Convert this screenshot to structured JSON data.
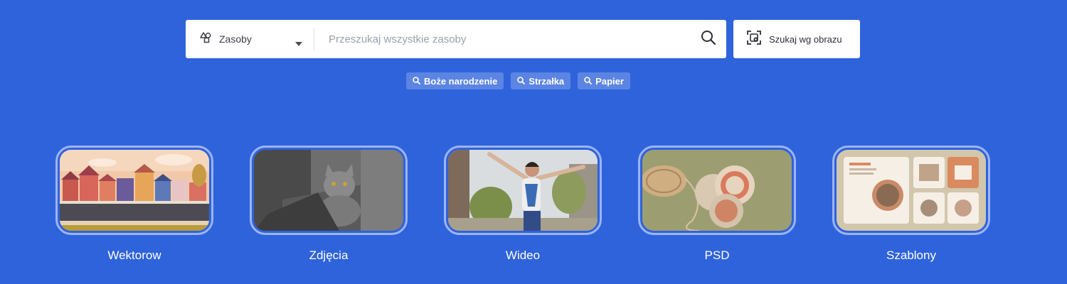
{
  "search": {
    "category_label": "Zasoby",
    "placeholder": "Przeszukaj wszystkie zasoby",
    "value": "",
    "image_search_label": "Szukaj wg obrazu"
  },
  "tags": [
    {
      "label": "Boże narodzenie",
      "icon": "search-icon"
    },
    {
      "label": "Strzałka",
      "icon": "search-icon"
    },
    {
      "label": "Papier",
      "icon": "search-icon"
    }
  ],
  "categories": [
    {
      "label": "Wektorow"
    },
    {
      "label": "Zdjęcia"
    },
    {
      "label": "Wideo"
    },
    {
      "label": "PSD"
    },
    {
      "label": "Szablony"
    }
  ],
  "icons": {
    "category": "shapes-icon",
    "chevron": "chevron-down-icon",
    "search": "search-icon",
    "image_search": "image-search-icon"
  },
  "colors": {
    "background": "#2f63dc",
    "thumb_border": "#9cb4f4",
    "tag_background": "rgba(255,255,255,0.22)"
  }
}
